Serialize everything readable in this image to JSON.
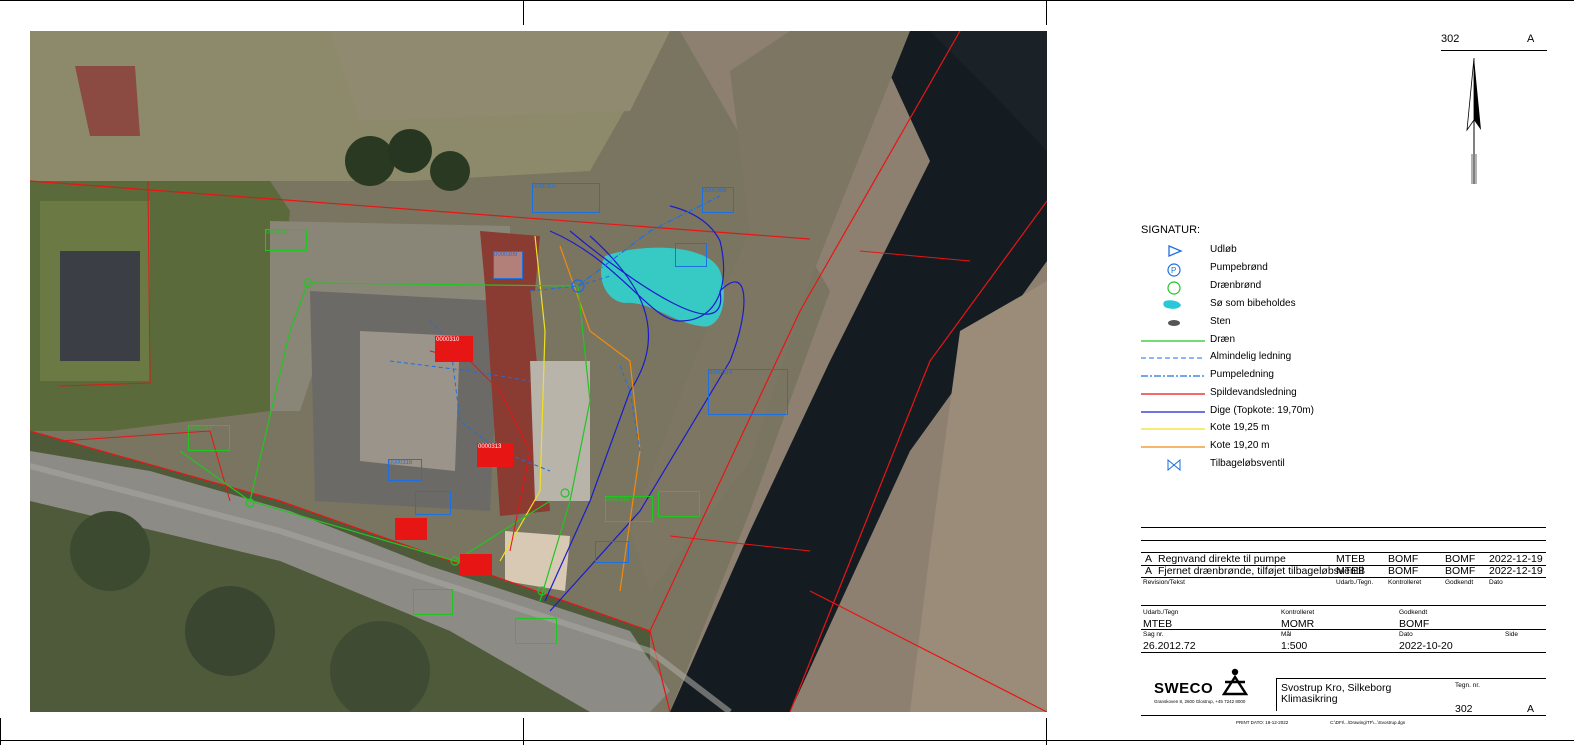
{
  "sheet": {
    "number": "302",
    "revision": "A"
  },
  "legend": {
    "title": "SIGNATUR:",
    "items": [
      {
        "label": "Udløb",
        "icon": "outlet-triangle-icon",
        "color": "#1e6fe0"
      },
      {
        "label": "Pumpebrønd",
        "icon": "pump-well-icon",
        "color": "#1e6fe0"
      },
      {
        "label": "Drænbrønd",
        "icon": "drain-well-icon",
        "color": "#22c422"
      },
      {
        "label": "Sø som bibeholdes",
        "icon": "lake-icon",
        "color": "#28c8d8"
      },
      {
        "label": "Sten",
        "icon": "stone-icon",
        "color": "#555555"
      },
      {
        "label": "Dræn",
        "icon": "line-solid",
        "color": "#22c422"
      },
      {
        "label": "Almindelig ledning",
        "icon": "line-dashed",
        "color": "#1e6fe0"
      },
      {
        "label": "Pumpeledning",
        "icon": "line-dashdot",
        "color": "#1e6fe0"
      },
      {
        "label": "Spildevandsledning",
        "icon": "line-solid",
        "color": "#e81515"
      },
      {
        "label": "Dige (Topkote: 19,70m)",
        "icon": "line-solid",
        "color": "#1c1ccc"
      },
      {
        "label": "Kote 19,25 m",
        "icon": "line-solid",
        "color": "#f0e020"
      },
      {
        "label": "Kote 19,20 m",
        "icon": "line-solid",
        "color": "#f08a10"
      },
      {
        "label": "Tilbageløbsventil",
        "icon": "check-valve-icon",
        "color": "#1e6fe0"
      }
    ]
  },
  "revisions": {
    "rows": [
      {
        "rev": "A",
        "text": "Regnvand direkte til pumpe",
        "drawn": "MTEB",
        "checked": "BOMF",
        "approved": "BOMF",
        "date": "2022-12-19"
      },
      {
        "rev": "A",
        "text": "Fjernet drænbrønde, tilføjet tilbageløbsventil",
        "drawn": "MTEB",
        "checked": "BOMF",
        "approved": "BOMF",
        "date": "2022-12-19"
      }
    ],
    "headers": {
      "text": "Revision/Tekst",
      "drawn": "Udarb./Tegn.",
      "checked": "Kontrolleret",
      "approved": "Godkendt",
      "date": "Dato"
    }
  },
  "title_block": {
    "drawn_label": "Udarb./Tegn",
    "drawn": "MTEB",
    "checked_label": "Kontrolleret",
    "checked": "MOMR",
    "approved_label": "Godkendt",
    "approved": "BOMF",
    "case_label": "Sag nr.",
    "case": "26.2012.72",
    "scale_label": "Mål",
    "scale": "1:500",
    "date_label": "Dato",
    "date": "2022-10-20",
    "page_label": "Side",
    "company": "SWECO",
    "company_address": "Granskoven 8, 2600 Glostrup, +45 7242 8000",
    "project_line1": "Svostrup Kro, Silkeborg",
    "project_line2": "Klimasikring",
    "drawing_no_label": "Tegn. nr.",
    "drawing_no": "302",
    "drawing_rev": "A",
    "print_date": "PRINT DATO: 19-12-2022",
    "file_path": "C:\\DFI\\...\\Drawing\\TF\\...\\Svostrup.dgn"
  },
  "map_labels": [
    {
      "text": "0000307",
      "color": "#1e6fe0"
    },
    {
      "text": "0000308",
      "color": "#1e6fe0"
    },
    {
      "text": "0000309",
      "color": "#1e6fe0"
    },
    {
      "text": "0000310",
      "color": "#e81515"
    },
    {
      "text": "0000311",
      "color": "#22c422"
    },
    {
      "text": "0000312",
      "color": "#22c422"
    },
    {
      "text": "0000313",
      "color": "#e81515"
    },
    {
      "text": "0000314",
      "color": "#1e6fe0"
    },
    {
      "text": "0000315",
      "color": "#22c422"
    },
    {
      "text": "0000316",
      "color": "#1e6fe0"
    }
  ]
}
